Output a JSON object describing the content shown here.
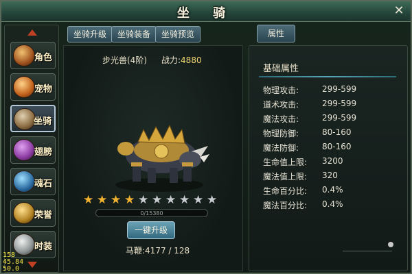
{
  "window": {
    "title": "坐 骑",
    "close_icon": "close-icon"
  },
  "sidebar": {
    "items": [
      {
        "label": "角色",
        "icon": "warrior-helmet-icon",
        "active": false
      },
      {
        "label": "宠物",
        "icon": "tiger-pet-icon",
        "active": false
      },
      {
        "label": "坐骑",
        "icon": "mount-horse-icon",
        "active": true
      },
      {
        "label": "翅膀",
        "icon": "wings-icon",
        "active": false
      },
      {
        "label": "魂石",
        "icon": "soul-stone-icon",
        "active": false
      },
      {
        "label": "荣誉",
        "icon": "honor-crest-icon",
        "active": false
      },
      {
        "label": "时装",
        "icon": "fashion-figure-icon",
        "active": false
      }
    ]
  },
  "debug_overlay": {
    "line1": "158",
    "line2": "45.84",
    "line3": "50.0"
  },
  "tabs": [
    {
      "label": "坐骑升级"
    },
    {
      "label": "坐骑装备"
    },
    {
      "label": "坐骑预览"
    }
  ],
  "mount": {
    "name": "步光兽(4阶)",
    "power_label": "战力:",
    "power_value": "4880",
    "stars_total": 10,
    "stars_filled": 4,
    "exp_text": "0/15380",
    "exp_fraction": 0.0,
    "upgrade_button": "一键升级",
    "whip_label": "马鞭:",
    "whip_value": "4177 / 128",
    "colors": {
      "star_filled": "#f2b230",
      "star_empty": "#c8ccd0"
    }
  },
  "attributes": {
    "tab_label": "属性",
    "heading": "基础属性",
    "rows": [
      {
        "label": "物理攻击:",
        "value": "299-599"
      },
      {
        "label": "道术攻击:",
        "value": "299-599"
      },
      {
        "label": "魔法攻击:",
        "value": "299-599"
      },
      {
        "label": "物理防御:",
        "value": "80-160"
      },
      {
        "label": "魔法防御:",
        "value": "80-160"
      },
      {
        "label": "生命值上限:",
        "value": "3200"
      },
      {
        "label": "魔法值上限:",
        "value": "320"
      },
      {
        "label": "生命百分比:",
        "value": "0.4%"
      },
      {
        "label": "魔法百分比:",
        "value": "0.4%"
      }
    ]
  }
}
